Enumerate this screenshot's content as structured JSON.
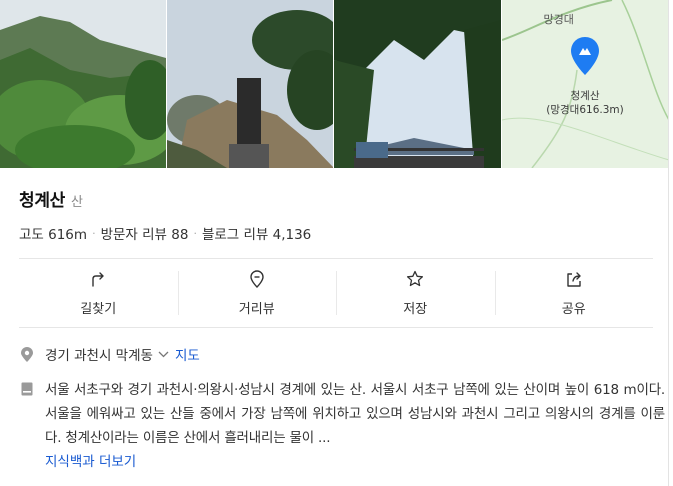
{
  "map": {
    "top_label": "망경대",
    "peak_name": "청계산",
    "peak_sub": "(망경대616.3m)"
  },
  "place": {
    "name": "청계산",
    "category": "산"
  },
  "stats": {
    "elevation": "고도 616m",
    "visitor_reviews": "방문자 리뷰 88",
    "blog_reviews": "블로그 리뷰 4,136"
  },
  "actions": [
    {
      "label": "길찾기",
      "icon": "directions-icon"
    },
    {
      "label": "거리뷰",
      "icon": "street-view-icon"
    },
    {
      "label": "저장",
      "icon": "star-icon"
    },
    {
      "label": "공유",
      "icon": "share-icon"
    }
  ],
  "address": {
    "text": "경기 과천시 막계동",
    "map_link": "지도"
  },
  "description": {
    "text": "서울 서초구와 경기 과천시·의왕시·성남시 경계에 있는 산. 서울시 서초구 남쪽에 있는 산이며 높이 618 m이다. 서울을 에워싸고 있는 산들 중에서 가장 남쪽에 위치하고 있으며 성남시와 과천시 그리고 의왕시의 경계를 이룬다. 청계산이라는 이름은 산에서 흘러내리는 물이 ...",
    "more_link": "지식백과 더보기"
  },
  "colors": {
    "link": "#1a5bd1",
    "pin": "#1e7cf2",
    "map_bg": "#e7f2e2"
  }
}
